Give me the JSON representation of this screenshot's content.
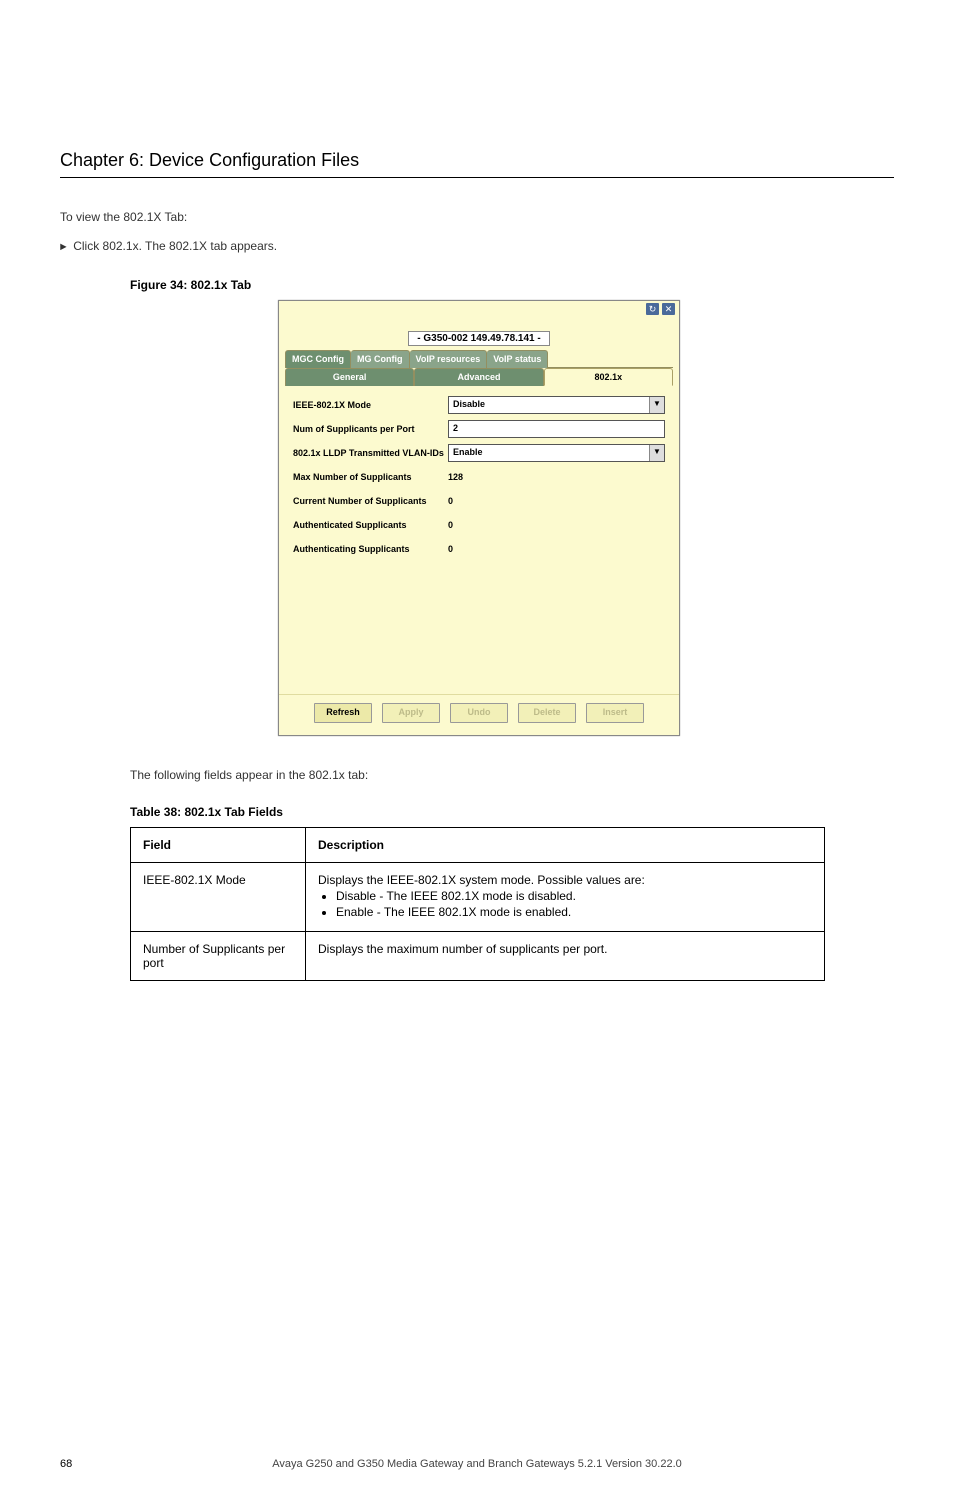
{
  "section_title": "Chapter 6: Device Configuration Files",
  "paragraphs": {
    "intro": "To view the 802.1X Tab:",
    "step": "Click 802.1x. The 802.1X tab appears.",
    "fields_caption": "The following fields appear in the 802.1x tab:"
  },
  "figure_label": "Figure 34: 802.1x Tab",
  "app": {
    "device_id": "- G350-002 149.49.78.141 -",
    "icons": {
      "refresh": "↻",
      "close": "✕"
    },
    "tabs_row1": [
      "MGC Config",
      "MG Config",
      "VoIP resources",
      "VoIP status"
    ],
    "tabs_row2": [
      "General",
      "Advanced",
      "802.1x"
    ],
    "active_tab": "802.1x",
    "rows": [
      {
        "label": "IEEE-802.1X Mode",
        "type": "combo",
        "value": "Disable"
      },
      {
        "label": "Num of Supplicants per Port",
        "type": "input",
        "value": "2"
      },
      {
        "label": "802.1x LLDP Transmitted VLAN-IDs",
        "type": "combo",
        "value": "Enable"
      },
      {
        "label": "Max Number of Supplicants",
        "type": "static",
        "value": "128"
      },
      {
        "label": "Current Number of Supplicants",
        "type": "static",
        "value": "0"
      },
      {
        "label": "Authenticated Supplicants",
        "type": "static",
        "value": "0"
      },
      {
        "label": "Authenticating Supplicants",
        "type": "static",
        "value": "0"
      }
    ],
    "buttons": [
      {
        "label": "Refresh",
        "enabled": true
      },
      {
        "label": "Apply",
        "enabled": false
      },
      {
        "label": "Undo",
        "enabled": false
      },
      {
        "label": "Delete",
        "enabled": false
      },
      {
        "label": "Insert",
        "enabled": false
      }
    ]
  },
  "table": {
    "caption": "Table 38: 802.1x Tab Fields",
    "headers": [
      "Field",
      "Description"
    ],
    "rows": [
      {
        "field": "IEEE-802.1X Mode",
        "desc": "Displays the IEEE-802.1X system mode. Possible values are:",
        "bullets": [
          "Disable - The IEEE 802.1X mode is disabled.",
          "Enable - The IEEE 802.1X mode is enabled."
        ]
      },
      {
        "field": "Number of Supplicants per port",
        "desc": "Displays the maximum number of supplicants per port."
      }
    ]
  },
  "footer": {
    "page": "68",
    "text": "Avaya G250 and G350 Media Gateway and Branch Gateways 5.2.1 Version 30.22.0"
  }
}
